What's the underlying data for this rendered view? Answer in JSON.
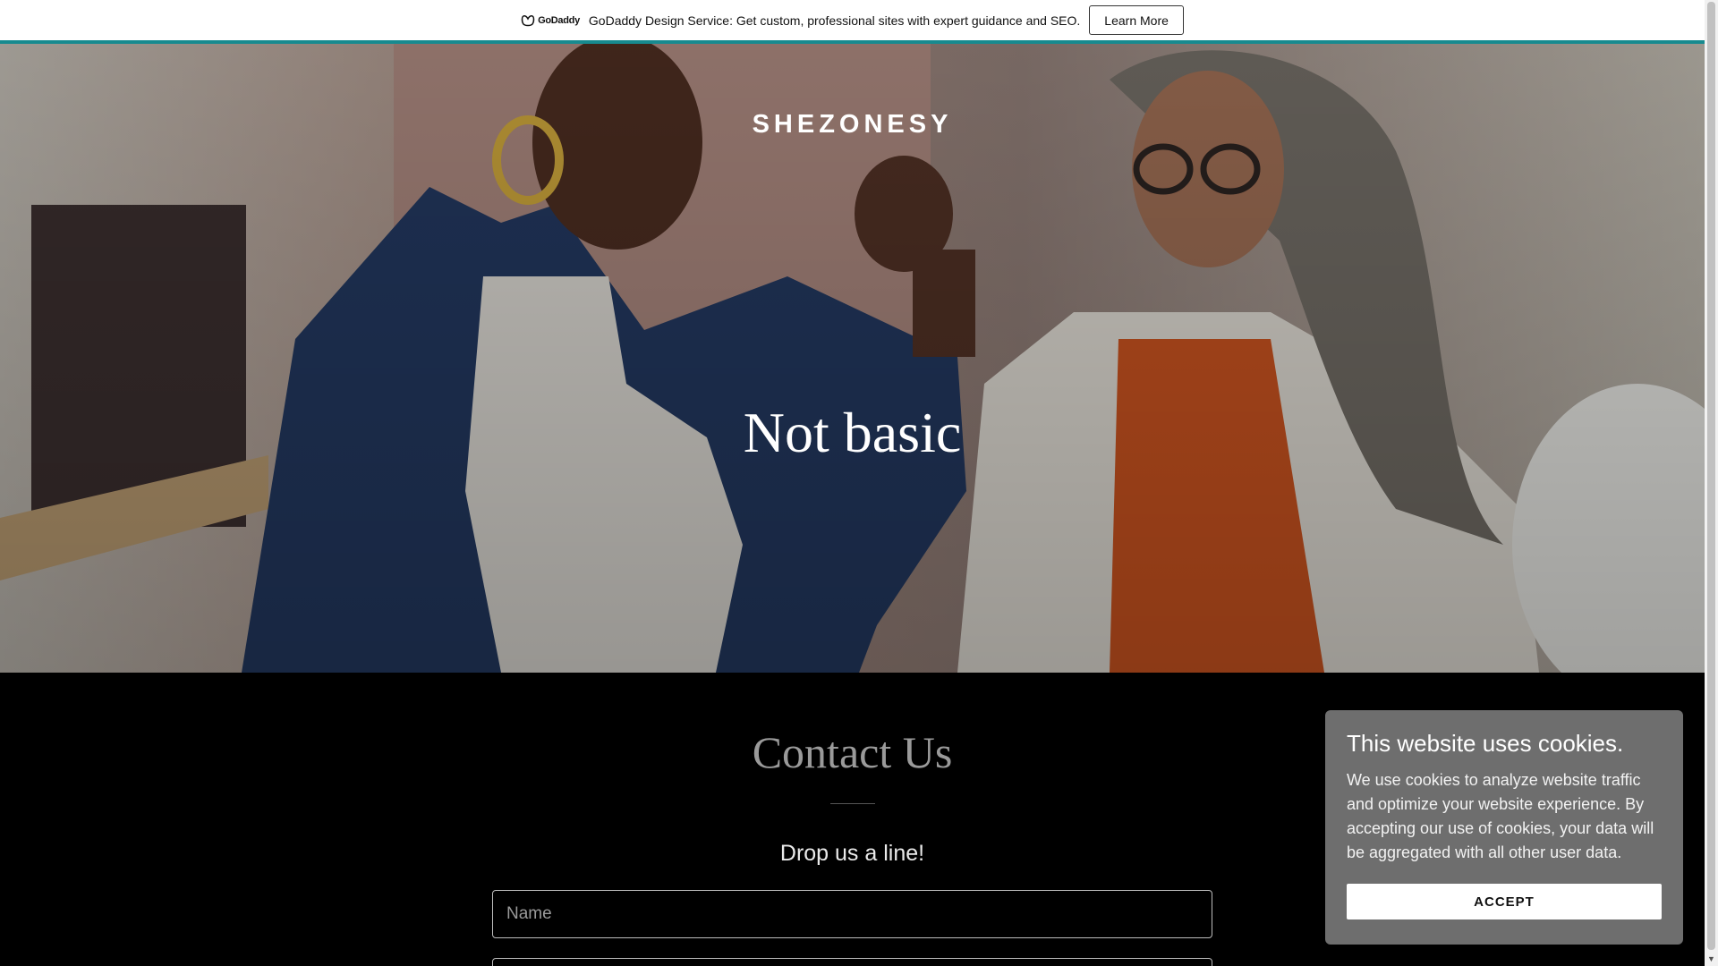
{
  "promo": {
    "logo_text": "GoDaddy",
    "text": "GoDaddy Design Service: Get custom, professional sites with expert guidance and SEO.",
    "button_label": "Learn More"
  },
  "colors": {
    "accent": "#178a8f",
    "cookie_bg": "#6e6e6e"
  },
  "hero": {
    "site_title": "SHEZONESY",
    "heading": "Not basic"
  },
  "contact": {
    "title": "Contact Us",
    "subtitle": "Drop us a line!",
    "name_placeholder": "Name",
    "email_placeholder": ""
  },
  "cookie_banner": {
    "title": "This website uses cookies.",
    "text": "We use cookies to analyze website traffic and optimize your website experience. By accepting our use of cookies, your data will be aggregated with all other user data.",
    "accept_label": "ACCEPT"
  }
}
